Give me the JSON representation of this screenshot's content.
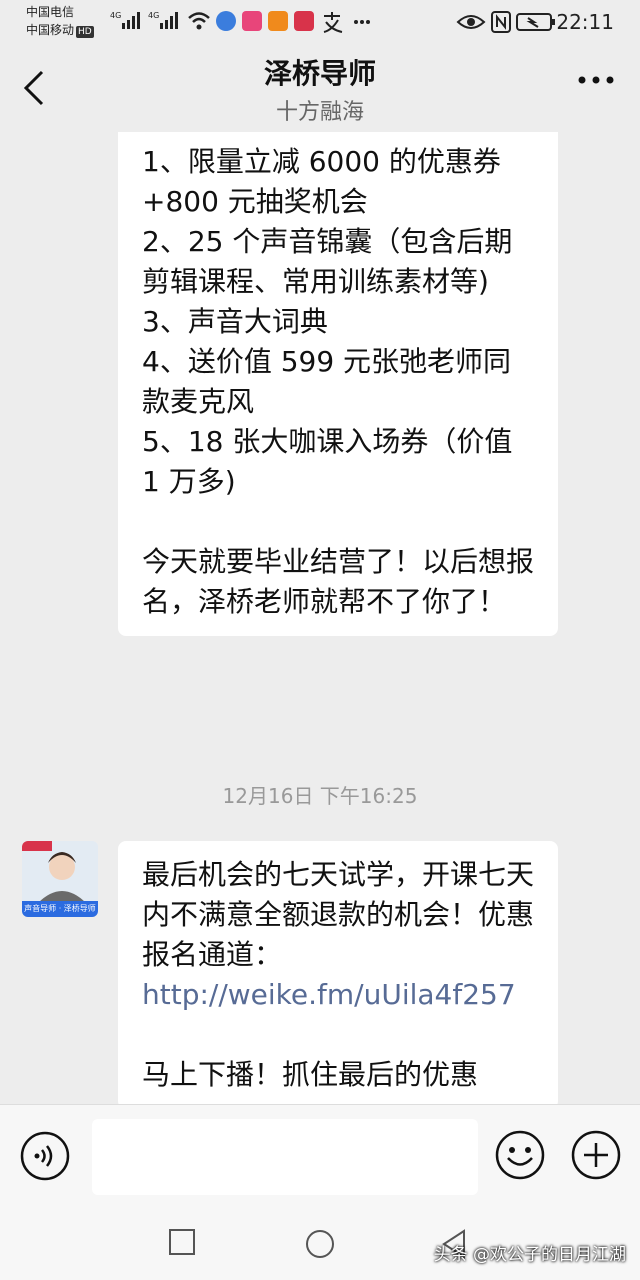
{
  "status_bar": {
    "carrier1": "中国电信",
    "carrier2": "中国移动",
    "hd": "HD",
    "net1": "4G",
    "net2": "4G",
    "time": "22:11"
  },
  "header": {
    "title": "泽桥导师",
    "subtitle": "十方融海"
  },
  "messages": {
    "first": {
      "lines": [
        "1、限量立减 6000 的优惠券+800 元抽奖机会",
        "2、25 个声音锦囊（包含后期剪辑课程、常用训练素材等)",
        "3、声音大词典",
        "4、送价值 599 元张弛老师同款麦克风",
        "5、18 张大咖课入场券（价值 1 万多)",
        "今天就要毕业结营了！以后想报名，泽桥老师就帮不了你了！"
      ]
    },
    "timestamp": "12月16日 下午16:25",
    "second": {
      "text": "最后机会的七天试学，开课七天内不满意全额退款的机会！优惠报名通道：",
      "link": "http://weike.fm/uUila4f257",
      "text2": "马上下播！抓住最后的优惠"
    },
    "avatar": {
      "badge": "声音导师 · 泽桥导师"
    }
  },
  "input_bar": {
    "placeholder": ""
  },
  "watermark": "头条 @欢公子的日月江湖"
}
